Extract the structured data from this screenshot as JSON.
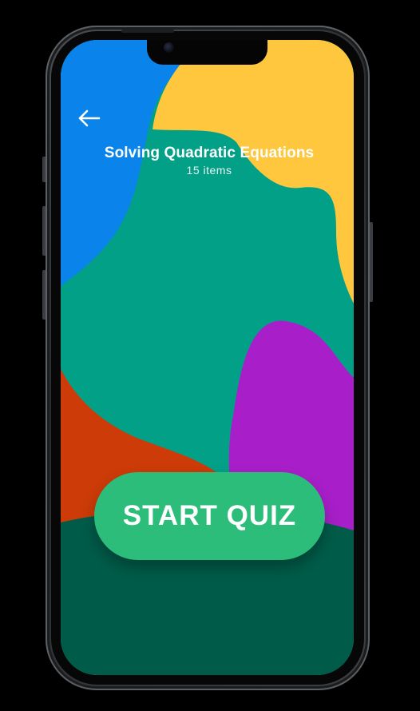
{
  "quiz": {
    "title": "Solving Quadratic Equations",
    "item_count": "15 items"
  },
  "actions": {
    "start_label": "START QUIZ"
  },
  "icons": {
    "back": "arrow-left-icon"
  },
  "colors": {
    "blue": "#0a84ea",
    "yellow": "#ffc73d",
    "teal": "#03a088",
    "purple": "#a81fc9",
    "orange": "#cc3b08",
    "dark_green": "#005c49",
    "button_green": "#2dbd7b"
  }
}
